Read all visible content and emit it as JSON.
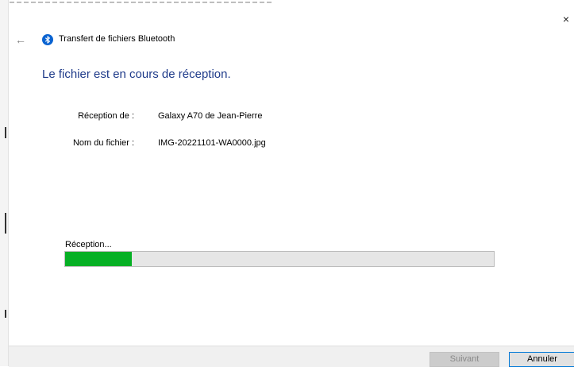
{
  "window": {
    "title": "Transfert de fichiers Bluetooth",
    "close_glyph": "×",
    "back_glyph": "←"
  },
  "headline": "Le fichier est en cours de réception.",
  "details": {
    "from_label": "Réception de :",
    "from_value": "Galaxy A70 de Jean-Pierre",
    "file_label": "Nom du fichier :",
    "file_value": "IMG-20221101-WA0000.jpg"
  },
  "progress": {
    "label": "Réception...",
    "fraction": 0.155,
    "fill_color": "#06b025"
  },
  "buttons": {
    "next": "Suivant",
    "cancel": "Annuler"
  },
  "icons": {
    "bluetooth": "bluetooth-icon",
    "back": "back-arrow-icon",
    "close": "close-icon"
  },
  "colors": {
    "headline": "#1f3b8a",
    "bluetooth": "#0a63d1",
    "accent_border": "#0078d7"
  }
}
